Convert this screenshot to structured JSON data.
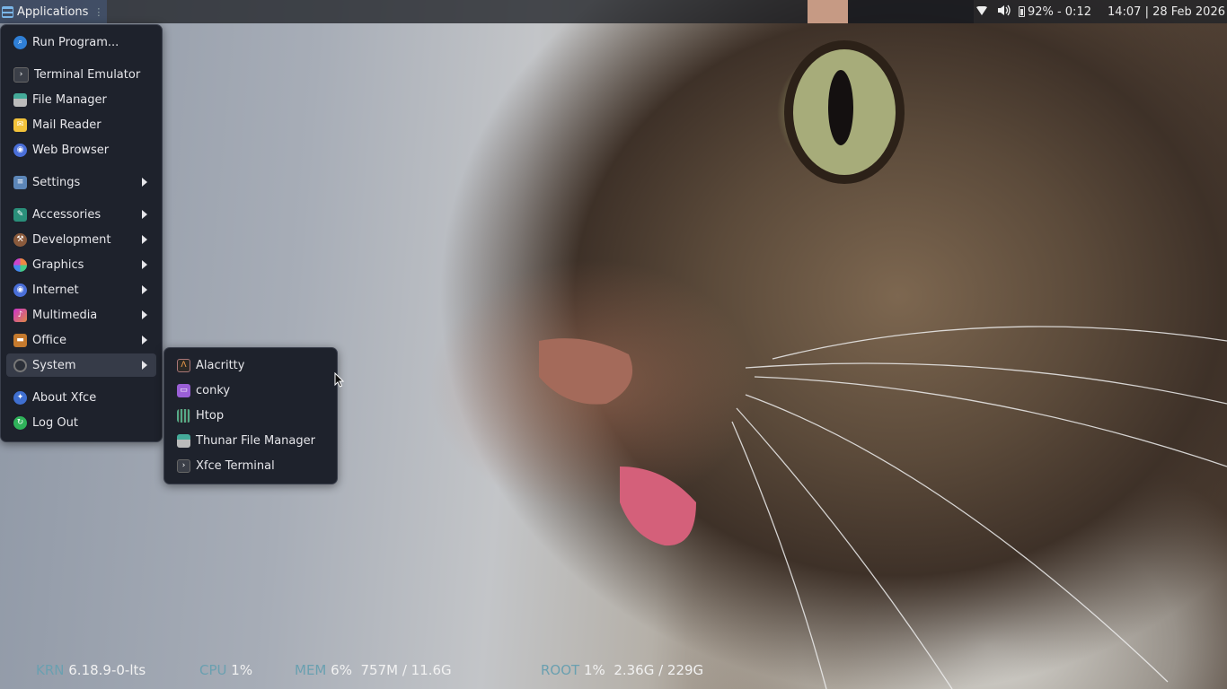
{
  "panel": {
    "apps_label": "Applications",
    "apps_dots": "⋮",
    "battery_text": "92% - 0:12",
    "clock": "14:07 | 28 Feb 2026",
    "icons": [
      "applications-icon",
      "wifi-icon",
      "volume-icon",
      "battery-icon"
    ]
  },
  "main_menu": {
    "items": [
      {
        "label": "Run Program...",
        "icon": "run-icon"
      },
      {
        "label": "Terminal Emulator",
        "icon": "terminal-icon"
      },
      {
        "label": "File Manager",
        "icon": "file-manager-icon"
      },
      {
        "label": "Mail Reader",
        "icon": "mail-icon"
      },
      {
        "label": "Web Browser",
        "icon": "browser-icon"
      },
      {
        "label": "Settings",
        "icon": "settings-icon"
      },
      {
        "label": "Accessories",
        "icon": "accessories-icon"
      },
      {
        "label": "Development",
        "icon": "development-icon"
      },
      {
        "label": "Graphics",
        "icon": "graphics-icon"
      },
      {
        "label": "Internet",
        "icon": "internet-icon"
      },
      {
        "label": "Multimedia",
        "icon": "multimedia-icon"
      },
      {
        "label": "Office",
        "icon": "office-icon"
      },
      {
        "label": "System",
        "icon": "system-icon"
      },
      {
        "label": "About Xfce",
        "icon": "xfce-icon"
      },
      {
        "label": "Log Out",
        "icon": "logout-icon"
      }
    ]
  },
  "system_submenu": {
    "items": [
      {
        "label": "Alacritty",
        "icon": "alacritty-icon"
      },
      {
        "label": "conky",
        "icon": "conky-icon"
      },
      {
        "label": "Htop",
        "icon": "htop-icon"
      },
      {
        "label": "Thunar File Manager",
        "icon": "thunar-icon"
      },
      {
        "label": "Xfce Terminal",
        "icon": "terminal-icon"
      }
    ]
  },
  "conky": {
    "krn_key": "KRN",
    "krn_val": "6.18.9-0-lts",
    "cpu_key": "CPU",
    "cpu_val": "1%",
    "mem_key": "MEM",
    "mem_val": "6%  757M / 11.6G",
    "root_key": "ROOT",
    "root_val": "1%  2.36G / 229G"
  },
  "colors": {
    "panel_bg": "#202228",
    "menu_bg": "#1e222c",
    "highlight": "#363b48",
    "conky_key": "#6aa0b0"
  }
}
